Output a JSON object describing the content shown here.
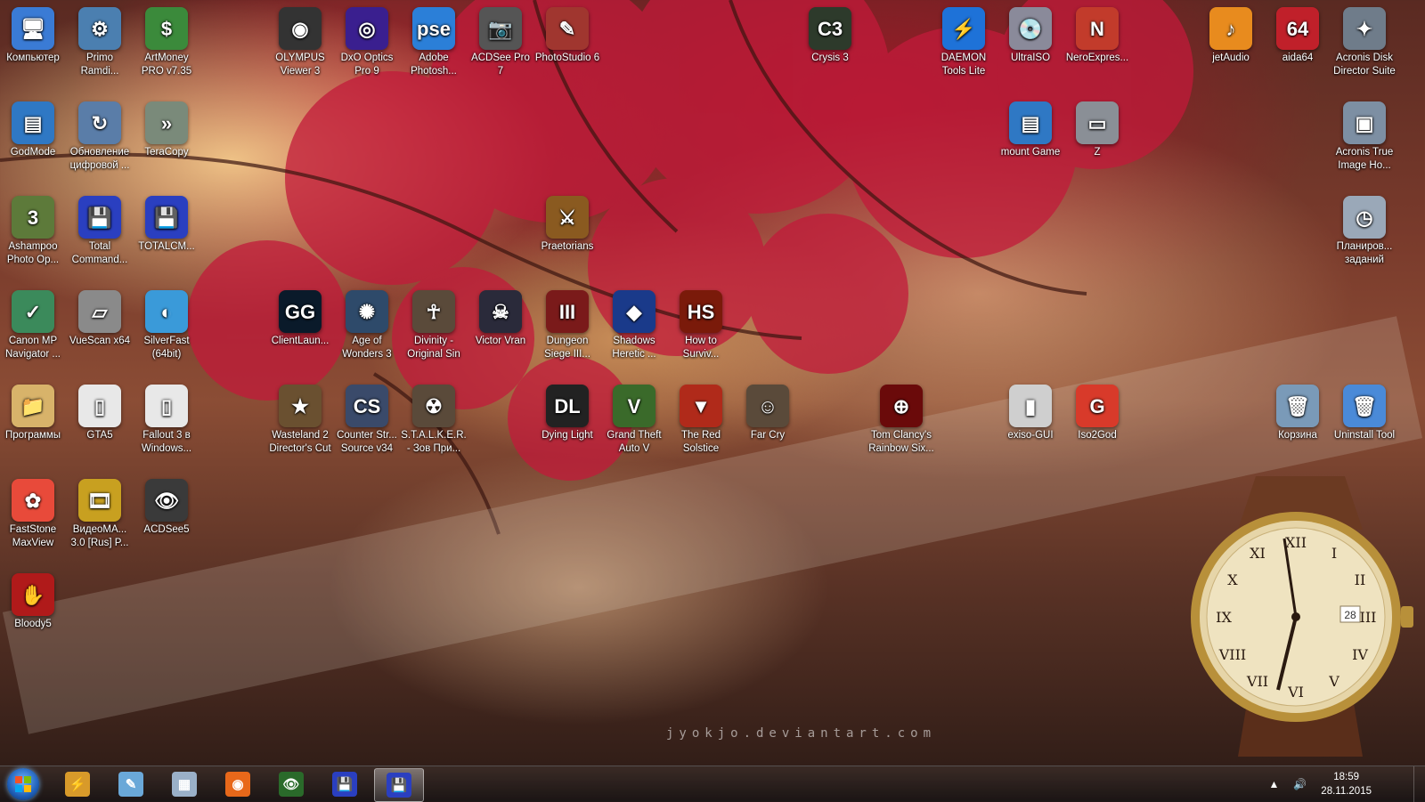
{
  "desktop": {
    "icons": [
      {
        "label": "Компьютер",
        "glyph": "🖥",
        "color": "#3a7bd5"
      },
      {
        "label": "Primo Ramdi...",
        "glyph": "⚙",
        "color": "#4b7fb0"
      },
      {
        "label": "ArtMoney PRO v7.35",
        "glyph": "$",
        "color": "#3b8a3b"
      },
      {
        "label": "OLYMPUS Viewer 3",
        "glyph": "◉",
        "color": "#333333"
      },
      {
        "label": "DxO Optics Pro 9",
        "glyph": "◎",
        "color": "#3a1f8f"
      },
      {
        "label": "Adobe Photosh...",
        "glyph": "pse",
        "color": "#2b7fd8"
      },
      {
        "label": "ACDSee Pro 7",
        "glyph": "📷",
        "color": "#555555"
      },
      {
        "label": "PhotoStudio 6",
        "glyph": "✎",
        "color": "#a0362f"
      },
      {
        "label": "Crysis 3",
        "glyph": "C3",
        "color": "#2d3a2b"
      },
      {
        "label": "DAEMON Tools Lite",
        "glyph": "⚡",
        "color": "#1e72d8"
      },
      {
        "label": "UltraISO",
        "glyph": "💿",
        "color": "#8a8a9a"
      },
      {
        "label": "NeroExpres...",
        "glyph": "N",
        "color": "#c23b2b"
      },
      {
        "label": "jetAudio",
        "glyph": "♪",
        "color": "#e88b1e"
      },
      {
        "label": "aida64",
        "glyph": "64",
        "color": "#c0202a"
      },
      {
        "label": "Acronis Disk Director Suite",
        "glyph": "✦",
        "color": "#6f7c8a"
      },
      {
        "label": "GodMode",
        "glyph": "▤",
        "color": "#2f78c4"
      },
      {
        "label": "Обновление цифровой ...",
        "glyph": "↻",
        "color": "#5a7da8"
      },
      {
        "label": "TeraCopy",
        "glyph": "»",
        "color": "#7a8a7a"
      },
      {
        "label": "mount Game",
        "glyph": "▤",
        "color": "#2f78c4"
      },
      {
        "label": "Z",
        "glyph": "▭",
        "color": "#8a8f96"
      },
      {
        "label": "Acronis True Image Ho...",
        "glyph": "▣",
        "color": "#7d8fa3"
      },
      {
        "label": "Ashampoo Photo Op...",
        "glyph": "3",
        "color": "#5d7a3a"
      },
      {
        "label": "Total Command...",
        "glyph": "💾",
        "color": "#2a3fc0"
      },
      {
        "label": "TOTALCM...",
        "glyph": "💾",
        "color": "#2a3fc0"
      },
      {
        "label": "Praetorians",
        "glyph": "⚔",
        "color": "#8a5a20"
      },
      {
        "label": "Планиров... заданий",
        "glyph": "◷",
        "color": "#9aa8b8"
      },
      {
        "label": "Canon MP Navigator ...",
        "glyph": "✓",
        "color": "#3b8a5b"
      },
      {
        "label": "VueScan x64",
        "glyph": "▱",
        "color": "#8a8a8a"
      },
      {
        "label": "SilverFast (64bit)",
        "glyph": "◐",
        "color": "#3a9ad9"
      },
      {
        "label": "ClientLaun...",
        "glyph": "GG",
        "color": "#0a1a2a"
      },
      {
        "label": "Age of Wonders 3",
        "glyph": "✺",
        "color": "#2e4a6a"
      },
      {
        "label": "Divinity - Original Sin",
        "glyph": "☥",
        "color": "#5a4a3a"
      },
      {
        "label": "Victor Vran",
        "glyph": "☠",
        "color": "#2a2a3a"
      },
      {
        "label": "Dungeon Siege III...",
        "glyph": "III",
        "color": "#7a1a1a"
      },
      {
        "label": "Shadows Heretic ...",
        "glyph": "◆",
        "color": "#1a3a8a"
      },
      {
        "label": "How to Surviv...",
        "glyph": "HS",
        "color": "#7a1a0a"
      },
      {
        "label": "Программы",
        "glyph": "📁",
        "color": "#d8b36a"
      },
      {
        "label": "GTA5",
        "glyph": "▯",
        "color": "#e8e8e8"
      },
      {
        "label": "Fallout 3 в Windows...",
        "glyph": "▯",
        "color": "#e8e8e8"
      },
      {
        "label": "Wasteland 2 Director's Cut",
        "glyph": "★",
        "color": "#6a5030"
      },
      {
        "label": "Counter Str... Source v34",
        "glyph": "CS",
        "color": "#3a4a6a"
      },
      {
        "label": "S.T.A.L.K.E.R. - Зов При...",
        "glyph": "☢",
        "color": "#5a4a3a"
      },
      {
        "label": "Dying Light",
        "glyph": "DL",
        "color": "#222222"
      },
      {
        "label": "Grand Theft Auto V",
        "glyph": "V",
        "color": "#3a6a2a"
      },
      {
        "label": "The Red Solstice",
        "glyph": "▼",
        "color": "#b02a1a"
      },
      {
        "label": "Far Cry",
        "glyph": "☺",
        "color": "#5a4a3a"
      },
      {
        "label": "Tom Clancy's Rainbow Six...",
        "glyph": "⊕",
        "color": "#6a0a0a"
      },
      {
        "label": "exiso-GUI",
        "glyph": "▮",
        "color": "#cfcfcf"
      },
      {
        "label": "Iso2God",
        "glyph": "G",
        "color": "#d83a2a"
      },
      {
        "label": "Корзина",
        "glyph": "🗑",
        "color": "#7a9ab8"
      },
      {
        "label": "Uninstall Tool",
        "glyph": "🗑",
        "color": "#4a8ad8"
      },
      {
        "label": "FastStone MaxView",
        "glyph": "✿",
        "color": "#e84a3a"
      },
      {
        "label": "ВидеоМА... 3.0 [Rus] P...",
        "glyph": "🎞",
        "color": "#c8a020"
      },
      {
        "label": "ACDSee5",
        "glyph": "👁",
        "color": "#3a3a3a"
      },
      {
        "label": "Bloody5",
        "glyph": "✋",
        "color": "#b01a1a"
      }
    ]
  },
  "watermark": "jyokjo.deviantart.com",
  "widget": {
    "name": "clock-gadget",
    "date_window": "28"
  },
  "taskbar": {
    "pinned": [
      {
        "name": "start-button"
      },
      {
        "name": "winamp-icon",
        "glyph": "⚡",
        "color": "#d89a2a"
      },
      {
        "name": "notepad-icon",
        "glyph": "✎",
        "color": "#6aa8d8"
      },
      {
        "name": "calculator-icon",
        "glyph": "▦",
        "color": "#9ab0c8"
      },
      {
        "name": "firefox-icon",
        "glyph": "◉",
        "color": "#e8681a"
      },
      {
        "name": "acdsee-icon",
        "glyph": "👁",
        "color": "#2a6a2a"
      },
      {
        "name": "total-commander-icon",
        "glyph": "💾",
        "color": "#2a3fc0"
      },
      {
        "name": "total-commander-active-icon",
        "glyph": "💾",
        "color": "#2a3fc0"
      }
    ],
    "time": "18:59",
    "date": "28.11.2015",
    "tray_arrow": "▲",
    "volume": "🔊"
  }
}
